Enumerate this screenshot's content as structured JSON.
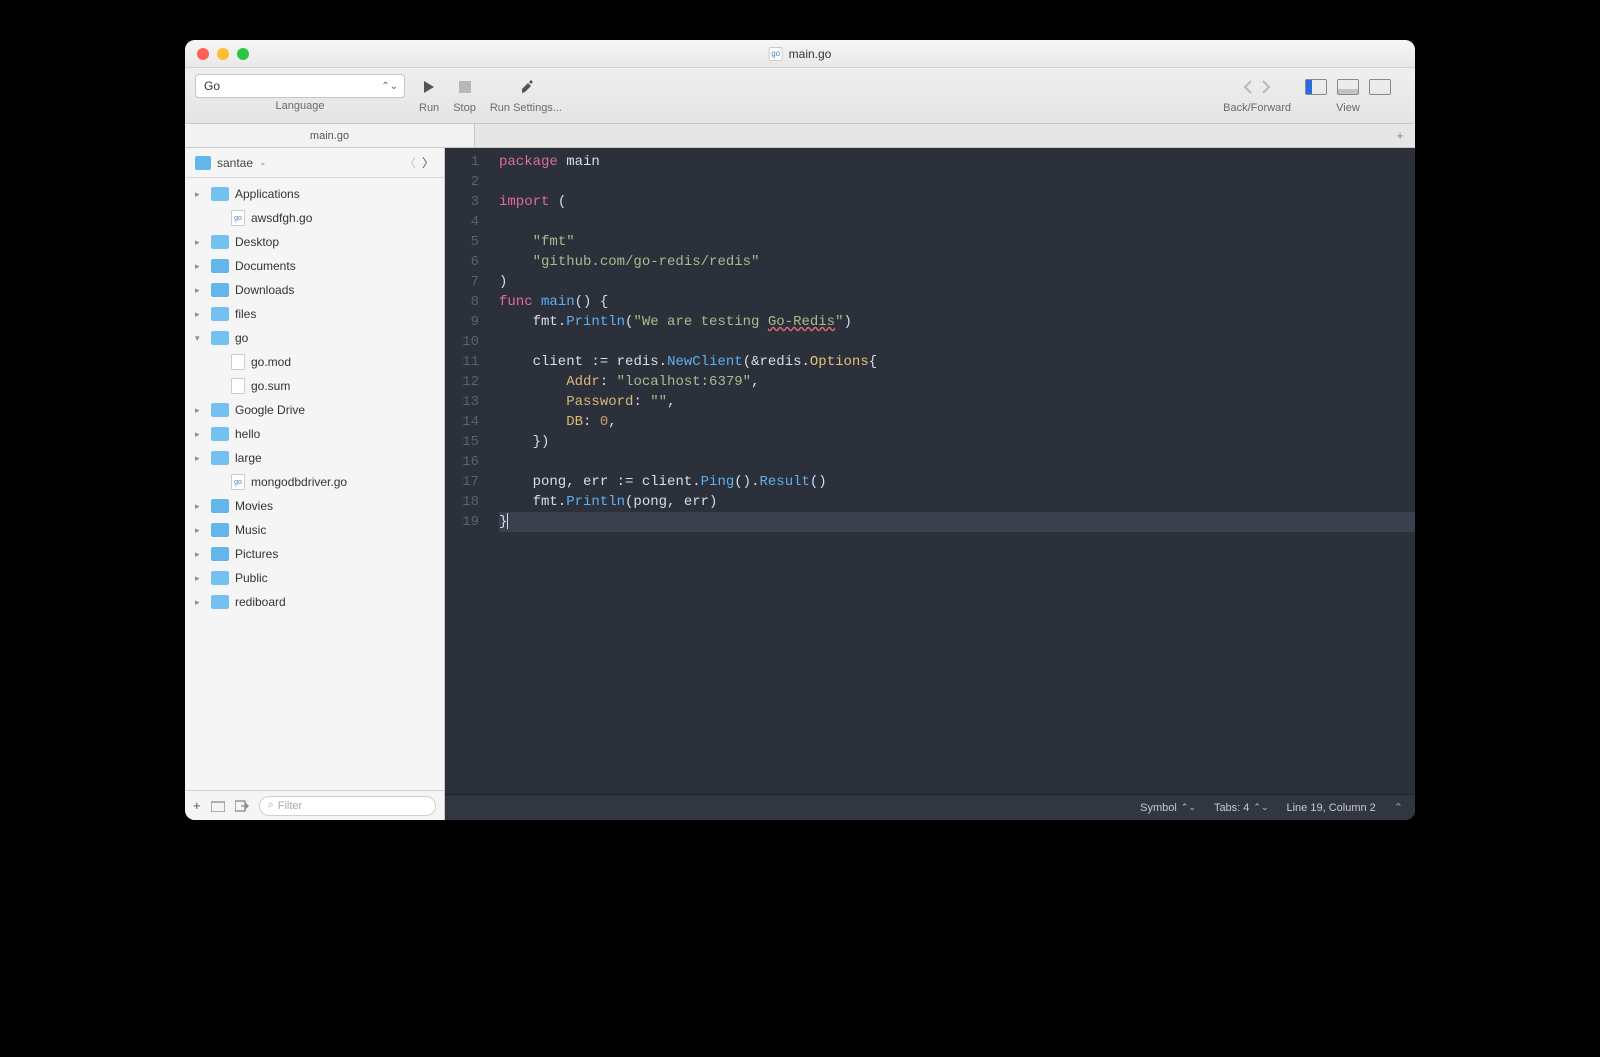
{
  "window": {
    "title": "main.go"
  },
  "toolbar": {
    "language": "Go",
    "language_label": "Language",
    "run": "Run",
    "stop": "Stop",
    "settings": "Run Settings...",
    "back_forward": "Back/Forward",
    "view": "View"
  },
  "tab": {
    "name": "main.go"
  },
  "crumb": {
    "root": "santae"
  },
  "tree": [
    {
      "name": "Applications",
      "type": "folder",
      "expand": true
    },
    {
      "name": "awsdfgh.go",
      "type": "gofile",
      "indent": 1
    },
    {
      "name": "Desktop",
      "type": "folder",
      "expand": true
    },
    {
      "name": "Documents",
      "type": "sysfolder",
      "expand": true
    },
    {
      "name": "Downloads",
      "type": "sysfolder",
      "expand": true
    },
    {
      "name": "files",
      "type": "folder",
      "expand": false
    },
    {
      "name": "go",
      "type": "folder",
      "expand": false,
      "open": true
    },
    {
      "name": "go.mod",
      "type": "file",
      "indent": 1
    },
    {
      "name": "go.sum",
      "type": "file",
      "indent": 1
    },
    {
      "name": "Google Drive",
      "type": "folder",
      "expand": true
    },
    {
      "name": "hello",
      "type": "folder",
      "expand": true
    },
    {
      "name": "large",
      "type": "folder",
      "expand": true
    },
    {
      "name": "mongodbdriver.go",
      "type": "gofile",
      "indent": 1
    },
    {
      "name": "Movies",
      "type": "sysfolder",
      "expand": true
    },
    {
      "name": "Music",
      "type": "sysfolder",
      "expand": true
    },
    {
      "name": "Pictures",
      "type": "sysfolder",
      "expand": true
    },
    {
      "name": "Public",
      "type": "folder",
      "expand": true
    },
    {
      "name": "rediboard",
      "type": "folder",
      "expand": true
    }
  ],
  "side_bottom": {
    "filter_placeholder": "Filter"
  },
  "code": {
    "lines": [
      [
        {
          "t": "package ",
          "c": "pkg-kw"
        },
        {
          "t": "main",
          "c": "ident"
        }
      ],
      [],
      [
        {
          "t": "import ",
          "c": "pkg-kw"
        },
        {
          "t": "(",
          "c": "ident"
        }
      ],
      [],
      [
        {
          "t": "    ",
          "c": ""
        },
        {
          "t": "\"fmt\"",
          "c": "str"
        }
      ],
      [
        {
          "t": "    ",
          "c": ""
        },
        {
          "t": "\"github.com/go-redis/redis\"",
          "c": "str"
        }
      ],
      [
        {
          "t": ")",
          "c": "ident"
        }
      ],
      [
        {
          "t": "func ",
          "c": "pkg-kw"
        },
        {
          "t": "main",
          "c": "func"
        },
        {
          "t": "() {",
          "c": "ident"
        }
      ],
      [
        {
          "t": "    fmt.",
          "c": "ident"
        },
        {
          "t": "Println",
          "c": "func"
        },
        {
          "t": "(",
          "c": "ident"
        },
        {
          "t": "\"We are testing ",
          "c": "str"
        },
        {
          "t": "Go-Redis",
          "c": "str err-underline"
        },
        {
          "t": "\"",
          "c": "str"
        },
        {
          "t": ")",
          "c": "ident"
        }
      ],
      [],
      [
        {
          "t": "    client ",
          "c": "ident"
        },
        {
          "t": ":= ",
          "c": "ident"
        },
        {
          "t": "redis.",
          "c": "ident"
        },
        {
          "t": "NewClient",
          "c": "func"
        },
        {
          "t": "(&redis.",
          "c": "ident"
        },
        {
          "t": "Options",
          "c": "type"
        },
        {
          "t": "{",
          "c": "ident"
        }
      ],
      [
        {
          "t": "        ",
          "c": ""
        },
        {
          "t": "Addr",
          "c": "field"
        },
        {
          "t": ": ",
          "c": "ident"
        },
        {
          "t": "\"localhost:6379\"",
          "c": "str"
        },
        {
          "t": ",",
          "c": "ident"
        }
      ],
      [
        {
          "t": "        ",
          "c": ""
        },
        {
          "t": "Password",
          "c": "field"
        },
        {
          "t": ": ",
          "c": "ident"
        },
        {
          "t": "\"\"",
          "c": "str"
        },
        {
          "t": ",",
          "c": "ident"
        }
      ],
      [
        {
          "t": "        ",
          "c": ""
        },
        {
          "t": "DB",
          "c": "field"
        },
        {
          "t": ": ",
          "c": "ident"
        },
        {
          "t": "0",
          "c": "num"
        },
        {
          "t": ",",
          "c": "ident"
        }
      ],
      [
        {
          "t": "    })",
          "c": "ident"
        }
      ],
      [],
      [
        {
          "t": "    pong, err ",
          "c": "ident"
        },
        {
          "t": ":= ",
          "c": "ident"
        },
        {
          "t": "client.",
          "c": "ident"
        },
        {
          "t": "Ping",
          "c": "func"
        },
        {
          "t": "().",
          "c": "ident"
        },
        {
          "t": "Result",
          "c": "func"
        },
        {
          "t": "()",
          "c": "ident"
        }
      ],
      [
        {
          "t": "    fmt.",
          "c": "ident"
        },
        {
          "t": "Println",
          "c": "func"
        },
        {
          "t": "(pong, err)",
          "c": "ident"
        }
      ],
      [
        {
          "t": "}",
          "c": "ident"
        }
      ]
    ],
    "highlight_line": 19
  },
  "status": {
    "symbol": "Symbol",
    "tabs": "Tabs: 4",
    "position": "Line 19, Column 2"
  }
}
